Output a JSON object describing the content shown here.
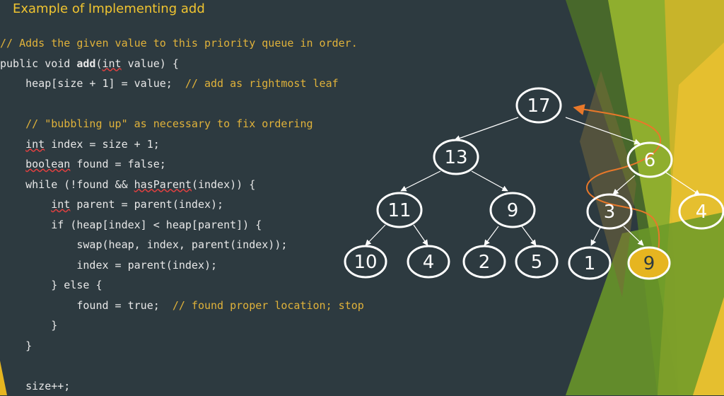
{
  "slide": {
    "title": "Example of Implementing add"
  },
  "code": {
    "line1": "// Adds the given value to this priority queue in order.",
    "line2_a": "public void ",
    "line2_method": "add",
    "line2_b": "(",
    "line2_int": "int",
    "line2_c": " value) {",
    "line3_code": "    heap[size + 1] = value;  ",
    "line3_comment": "// add as rightmost leaf",
    "line5": "    // \"bubbling up\" as necessary to fix ordering",
    "line6_indent": "    ",
    "line6_int": "int",
    "line6_rest": " index = size + 1;",
    "line7_indent": "    ",
    "line7_bool": "boolean",
    "line7_rest": " found = false;",
    "line8_a": "    while (!found && ",
    "line8_fn": "hasParent",
    "line8_b": "(index)) {",
    "line9_indent": "        ",
    "line9_int": "int",
    "line9_rest": " parent = parent(index);",
    "line10": "        if (heap[index] < heap[parent]) {",
    "line11": "            swap(heap, index, parent(index));",
    "line12": "            index = parent(index);",
    "line13": "        } else {",
    "line14_code": "            found = true;  ",
    "line14_comment": "// found proper location; stop",
    "line15": "        }",
    "line16": "    }",
    "line18": "    size++;"
  },
  "heap": {
    "nodes": {
      "n17": "17",
      "n13": "13",
      "n6": "6",
      "n11": "11",
      "n9a": "9",
      "n3": "3",
      "n4a": "4",
      "n10": "10",
      "n4b": "4",
      "n2": "2",
      "n5": "5",
      "n1": "1",
      "n9b": "9"
    },
    "highlight_color": "#e6b520",
    "arrow_color": "#e8782a",
    "node_stroke": "#ffffff"
  }
}
